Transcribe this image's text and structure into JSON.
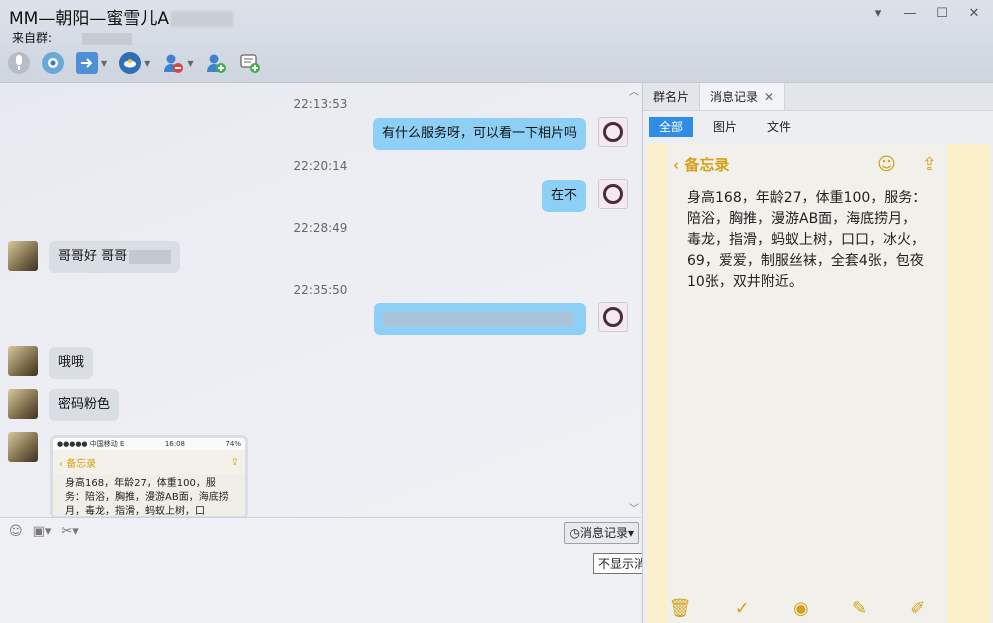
{
  "window": {
    "title": "MM—朝阳—蜜雪儿A",
    "source_label": "来自群:",
    "controls": {
      "dropdown": "▾",
      "minimize": "—",
      "maximize": "☐",
      "close": "✕"
    }
  },
  "toolbar": {
    "icons": [
      "microphone-icon",
      "video-icon",
      "file-transfer-icon",
      "share-screen-icon",
      "remove-member-icon",
      "add-member-icon",
      "message-icon"
    ]
  },
  "chat": {
    "messages": [
      {
        "side": "time",
        "text": "22:13:53"
      },
      {
        "side": "right",
        "text": "有什么服务呀，可以看一下相片吗"
      },
      {
        "side": "time",
        "text": "22:20:14"
      },
      {
        "side": "right",
        "text": "在不"
      },
      {
        "side": "time",
        "text": "22:28:49"
      },
      {
        "side": "left",
        "text": "哥哥好 哥哥"
      },
      {
        "side": "time",
        "text": "22:35:50"
      },
      {
        "side": "left",
        "text": "哦哦"
      },
      {
        "side": "left",
        "text": "密码粉色"
      }
    ],
    "thumbnail": {
      "carrier": "●●●●● 中国移动  E",
      "time": "16:08",
      "battery": "74%",
      "back_label": "备忘录",
      "text": "身高168，年龄27，体重100，服务：陪浴，胸推，漫游AB面，海底捞月，毒龙，指滑，蚂蚁上树，口"
    }
  },
  "input_bar": {
    "history_button": "消息记录",
    "tooltip": "不显示消息记录"
  },
  "right_panel": {
    "tabs": [
      {
        "label": "群名片"
      },
      {
        "label": "消息记录",
        "close": "✕"
      }
    ],
    "filters": [
      "全部",
      "图片",
      "文件"
    ],
    "memo": {
      "back_label": "备忘录",
      "text": "身高168，年龄27，体重100，服务：陪浴，胸推，漫游AB面，海底捞月，毒龙，指滑，蚂蚁上树，口口，冰火，69，爱爱，制服丝袜，全套4张，包夜10张，双井附近。"
    }
  },
  "colors": {
    "bubble_right": "#8ecff5",
    "bubble_left": "#d9dde4",
    "filter_active": "#2f8de3",
    "memo_accent": "#d3a21a"
  }
}
